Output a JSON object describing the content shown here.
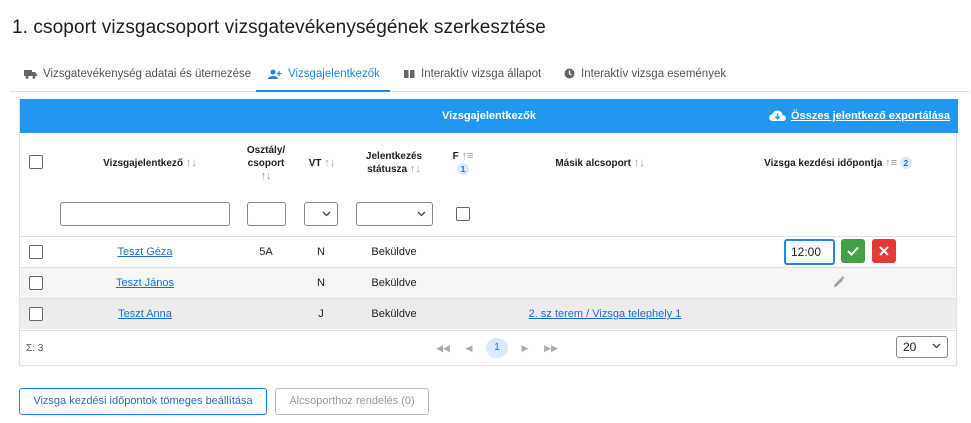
{
  "page": {
    "title": "1. csoport vizsgacsoport vizsgatevékenységének szerkesztése"
  },
  "tabs": [
    {
      "label": "Vizsgatevékenység adatai és ütemezése",
      "icon": "truck-icon"
    },
    {
      "label": "Vizsgajelentkezők",
      "icon": "user-plus-icon"
    },
    {
      "label": "Interaktív vizsga állapot",
      "icon": "columns-icon"
    },
    {
      "label": "Interaktív vizsga események",
      "icon": "clock-icon"
    }
  ],
  "panel": {
    "title": "Vizsgajelentkezők",
    "export_label": "Összes jelentkező exportálása"
  },
  "columns": {
    "name": "Vizsgajelentkező",
    "class_line1": "Osztály/",
    "class_line2": "csoport",
    "vt": "VT",
    "status_line1": "Jelentkezés",
    "status_line2": "státusza",
    "f": "F",
    "f_badge": "1",
    "subgroup": "Másik alcsoport",
    "start": "Vizsga kezdési időpontja",
    "start_badge": "2"
  },
  "rows": [
    {
      "name": "Teszt Géza",
      "class": "5A",
      "vt": "N",
      "status": "Beküldve",
      "subgroup": "",
      "time": "12:00"
    },
    {
      "name": "Teszt János",
      "class": "",
      "vt": "N",
      "status": "Beküldve",
      "subgroup": ""
    },
    {
      "name": "Teszt Anna",
      "class": "",
      "vt": "J",
      "status": "Beküldve",
      "subgroup": "2. sz terem / Vizsga telephely 1"
    }
  ],
  "footer": {
    "count": "Σ: 3",
    "current_page": "1",
    "page_size": "20"
  },
  "buttons": {
    "bulk_start": "Vizsga kezdési időpontok tömeges beállítása",
    "subgroup_assign": "Alcsoporthoz rendelés (0)"
  },
  "colors": {
    "accent": "#2196f3",
    "link": "#1e6fd0",
    "ok": "#43a047",
    "cancel": "#e53935"
  }
}
